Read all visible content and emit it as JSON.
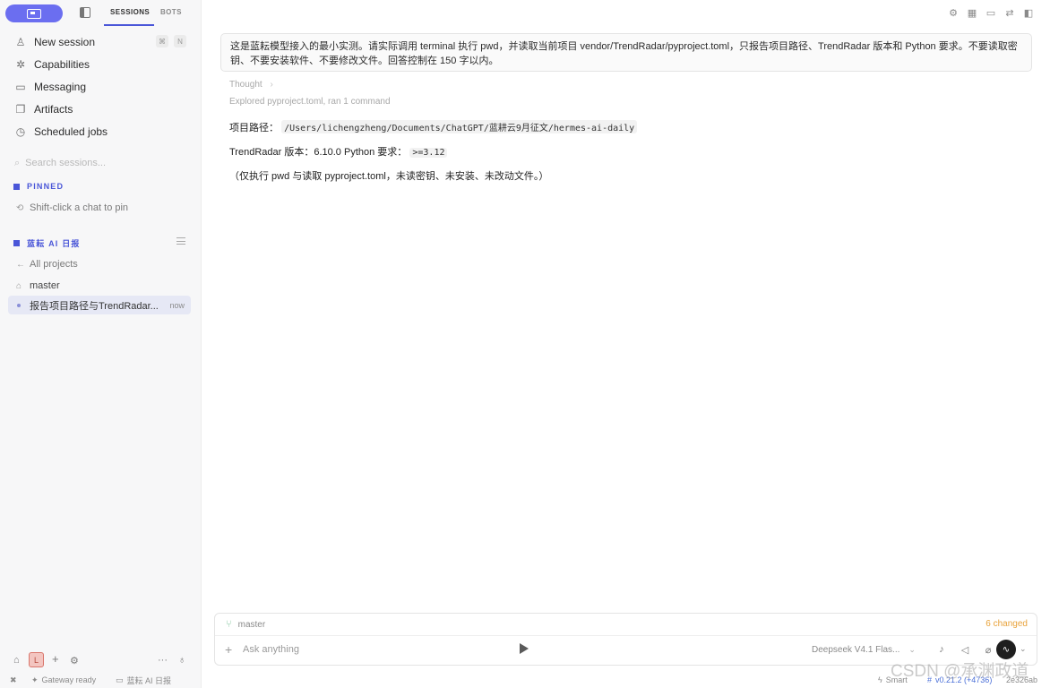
{
  "sidebar": {
    "tabs": [
      "SESSIONS",
      "BOTS"
    ],
    "nav": [
      {
        "label": "New session",
        "icon": "user-icon"
      },
      {
        "label": "Capabilities",
        "icon": "capabilities-icon"
      },
      {
        "label": "Messaging",
        "icon": "chat-icon"
      },
      {
        "label": "Artifacts",
        "icon": "file-icon"
      },
      {
        "label": "Scheduled jobs",
        "icon": "clock-icon"
      }
    ],
    "shortcut": [
      "⌘",
      "N"
    ],
    "search_placeholder": "Search sessions...",
    "pinned": {
      "title": "PINNED",
      "hint": "Shift-click a chat to pin"
    },
    "project": {
      "title": "蓝耘 AI 日报",
      "all_projects": "All projects",
      "branch": "master",
      "session_title": "报告项目路径与TrendRadar...",
      "session_time": "now"
    },
    "avatar_initial": "L",
    "more": "···"
  },
  "main": {
    "prompt": "这是蓝耘模型接入的最小实测。请实际调用 terminal 执行 pwd，并读取当前项目 vendor/TrendRadar/pyproject.toml，只报告项目路径、TrendRadar 版本和 Python 要求。不要读取密钥、不要安装软件、不要修改文件。回答控制在 150 字以内。",
    "thought": "Thought",
    "explored": "Explored pyproject.toml, ran 1 command",
    "path_label": "项目路径：",
    "path_value": "/Users/lichengzheng/Documents/ChatGPT/蓝耕云9月征文/hermes-ai-daily",
    "version_line": "TrendRadar 版本：6.10.0 Python 要求：",
    "python_req": ">=3.12",
    "note": "（仅执行 pwd 与读取 pyproject.toml，未读密钥、未安装、未改动文件。）"
  },
  "composer": {
    "branch": "master",
    "changed": "6 changed",
    "placeholder": "Ask anything",
    "model": "Deepseek V4.1 Flas..."
  },
  "status": {
    "gateway": "Gateway ready",
    "project": "蓝耘 AI 日报",
    "mode": "Smart",
    "version": "v0.21.2 (+4736)",
    "hash": "2e326ab"
  },
  "watermark": "CSDN @承渊政道",
  "colors": {
    "accent": "#4a56d8",
    "pill": "#6b6ef0",
    "changed": "#e8a23a"
  }
}
